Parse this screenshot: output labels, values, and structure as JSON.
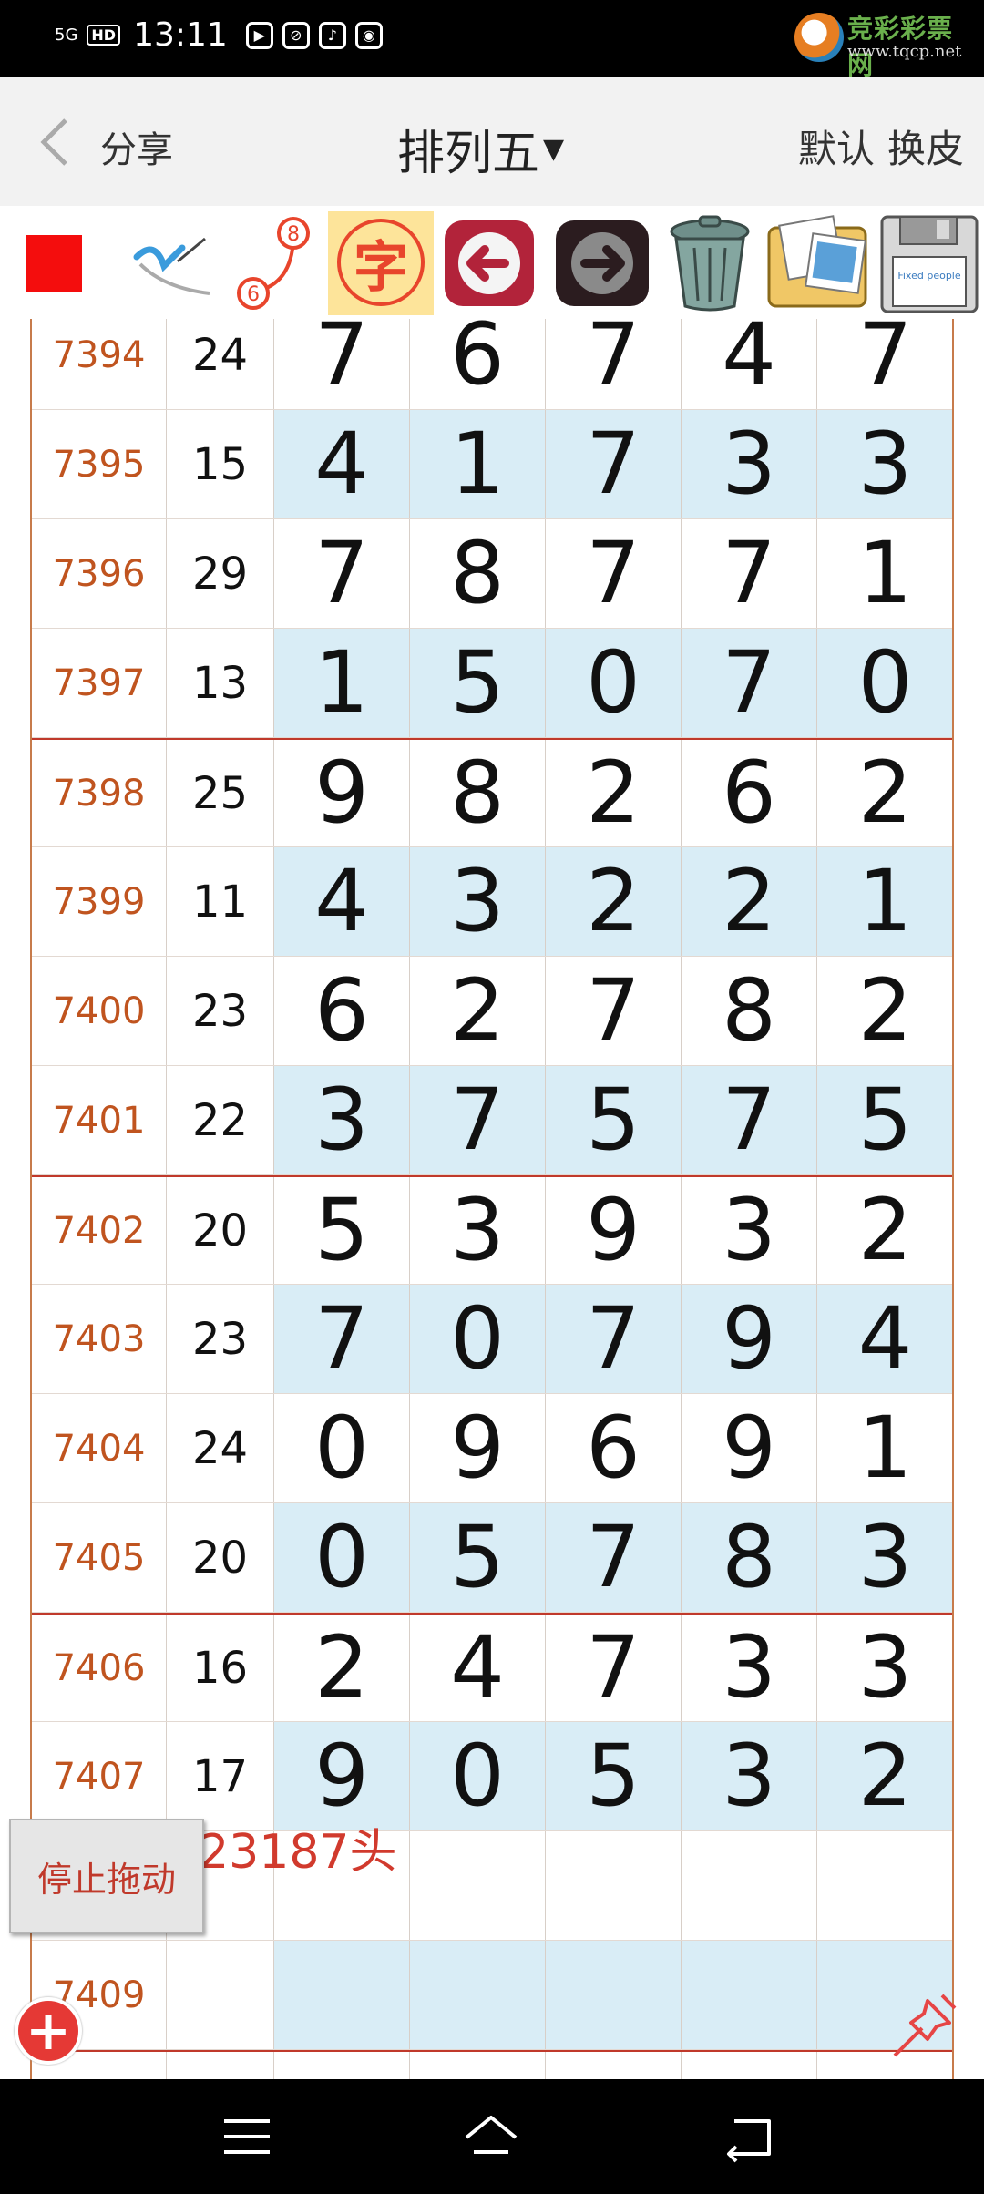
{
  "status_bar": {
    "network": "5G",
    "hd": "HD",
    "time": "13:11",
    "watermark_cn": "竞彩彩票网",
    "watermark_url": "www.tqcp.net"
  },
  "header": {
    "share_label": "分享",
    "title": "排列五",
    "default_label": "默认",
    "skin_label": "换皮"
  },
  "toolbar": {
    "char_tool_label": "字",
    "num_badge_top": "8",
    "num_badge_bottom": "6",
    "save_floppy_text": "Fixed people",
    "highlight_color": "#f40d0d"
  },
  "rows": [
    {
      "issue": "7394",
      "sum": "24",
      "digits": [
        "7",
        "6",
        "7",
        "4",
        "7"
      ],
      "shade": "white",
      "sep": false
    },
    {
      "issue": "7395",
      "sum": "15",
      "digits": [
        "4",
        "1",
        "7",
        "3",
        "3"
      ],
      "shade": "blue",
      "sep": false
    },
    {
      "issue": "7396",
      "sum": "29",
      "digits": [
        "7",
        "8",
        "7",
        "7",
        "1"
      ],
      "shade": "white",
      "sep": false
    },
    {
      "issue": "7397",
      "sum": "13",
      "digits": [
        "1",
        "5",
        "0",
        "7",
        "0"
      ],
      "shade": "blue",
      "sep": false
    },
    {
      "issue": "7398",
      "sum": "25",
      "digits": [
        "9",
        "8",
        "2",
        "6",
        "2"
      ],
      "shade": "white",
      "sep": true
    },
    {
      "issue": "7399",
      "sum": "11",
      "digits": [
        "4",
        "3",
        "2",
        "2",
        "1"
      ],
      "shade": "blue",
      "sep": false
    },
    {
      "issue": "7400",
      "sum": "23",
      "digits": [
        "6",
        "2",
        "7",
        "8",
        "2"
      ],
      "shade": "white",
      "sep": false
    },
    {
      "issue": "7401",
      "sum": "22",
      "digits": [
        "3",
        "7",
        "5",
        "7",
        "5"
      ],
      "shade": "blue",
      "sep": false
    },
    {
      "issue": "7402",
      "sum": "20",
      "digits": [
        "5",
        "3",
        "9",
        "3",
        "2"
      ],
      "shade": "white",
      "sep": true
    },
    {
      "issue": "7403",
      "sum": "23",
      "digits": [
        "7",
        "0",
        "7",
        "9",
        "4"
      ],
      "shade": "blue",
      "sep": false
    },
    {
      "issue": "7404",
      "sum": "24",
      "digits": [
        "0",
        "9",
        "6",
        "9",
        "1"
      ],
      "shade": "white",
      "sep": false
    },
    {
      "issue": "7405",
      "sum": "20",
      "digits": [
        "0",
        "5",
        "7",
        "8",
        "3"
      ],
      "shade": "blue",
      "sep": false
    },
    {
      "issue": "7406",
      "sum": "16",
      "digits": [
        "2",
        "4",
        "7",
        "3",
        "3"
      ],
      "shade": "white",
      "sep": true
    },
    {
      "issue": "7407",
      "sum": "17",
      "digits": [
        "9",
        "0",
        "5",
        "3",
        "2"
      ],
      "shade": "blue",
      "sep": false
    },
    {
      "issue": "",
      "sum": "",
      "digits": [
        "",
        "",
        "",
        "",
        ""
      ],
      "shade": "white",
      "sep": false
    },
    {
      "issue": "7409",
      "sum": "",
      "digits": [
        "",
        "",
        "",
        "",
        ""
      ],
      "shade": "blue",
      "sep": false
    },
    {
      "issue": "",
      "sum": "",
      "digits": [
        "",
        "",
        "",
        "",
        ""
      ],
      "shade": "white",
      "sep": true
    }
  ],
  "note": {
    "text": "423187头"
  },
  "floating": {
    "stop_drag_label": "停止拖动"
  },
  "colors": {
    "issue_text": "#c0541f",
    "row_blue": "#d9edf6",
    "separator": "#c0392b",
    "note_text": "#d13a2d"
  }
}
